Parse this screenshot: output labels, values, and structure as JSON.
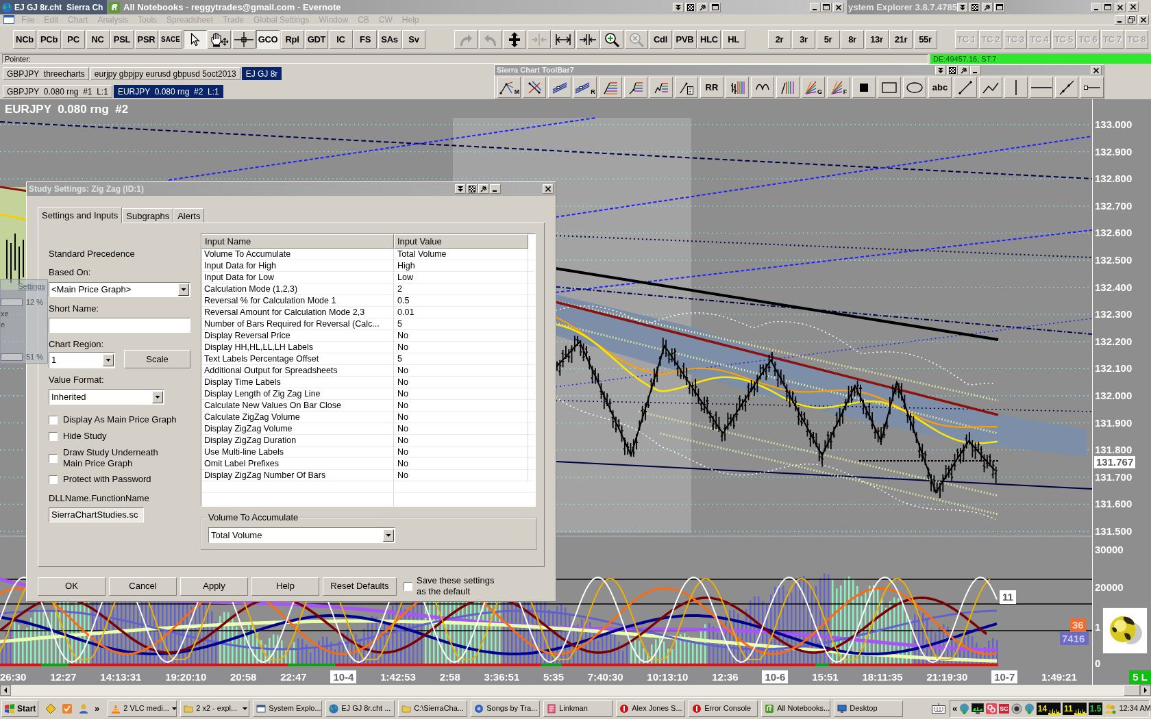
{
  "main_window": {
    "title": "EJ GJ 8r.cht  Sierra Ch"
  },
  "evernote_window": {
    "title": "All Notebooks - reggytrades@gmail.com - Evernote"
  },
  "explorer_window": {
    "title": "ystem Explorer 3.8.7.4785"
  },
  "menu_bar": [
    "File",
    "Edit",
    "Chart",
    "Analysis",
    "Tools",
    "Spreadsheet",
    "Trade",
    "Global Settings",
    "Window",
    "CB",
    "CW",
    "Help"
  ],
  "toolbar": [
    [
      {
        "kind": "text",
        "label": "NCb",
        "pressed": false,
        "disabled": false
      },
      {
        "kind": "text",
        "label": "PCb",
        "pressed": false,
        "disabled": false
      },
      {
        "kind": "text",
        "label": "PC",
        "pressed": false,
        "disabled": false
      },
      {
        "kind": "text",
        "label": "NC",
        "pressed": false,
        "disabled": false
      },
      {
        "kind": "text",
        "label": "PSL",
        "pressed": false,
        "disabled": false
      },
      {
        "kind": "text",
        "label": "PSR",
        "pressed": false,
        "disabled": false
      },
      {
        "kind": "smalltext",
        "label": "SACE",
        "pressed": false,
        "disabled": false
      },
      {
        "kind": "pointer",
        "pressed": true,
        "disabled": false
      },
      {
        "kind": "hand",
        "pressed": false,
        "disabled": false
      },
      {
        "kind": "crosshair",
        "pressed": false,
        "disabled": false
      },
      {
        "kind": "text",
        "label": "GCO",
        "pressed": true,
        "disabled": false
      },
      {
        "kind": "text",
        "label": "Rpl",
        "pressed": false,
        "disabled": false
      },
      {
        "kind": "text",
        "label": "GDT",
        "pressed": false,
        "disabled": false
      },
      {
        "kind": "text",
        "label": "IC",
        "pressed": false,
        "disabled": false
      },
      {
        "kind": "text",
        "label": "FS",
        "pressed": false,
        "disabled": false
      },
      {
        "kind": "text",
        "label": "SAs",
        "pressed": false,
        "disabled": false
      },
      {
        "kind": "text",
        "label": "Sv",
        "pressed": false,
        "disabled": false
      }
    ],
    [
      {
        "kind": "redo",
        "pressed": false,
        "disabled": true
      },
      {
        "kind": "undo",
        "pressed": false,
        "disabled": true
      },
      {
        "kind": "move",
        "pressed": false,
        "disabled": false
      },
      {
        "kind": "squeeze",
        "pressed": false,
        "disabled": true
      },
      {
        "kind": "stretch",
        "pressed": false,
        "disabled": false
      },
      {
        "kind": "compress",
        "pressed": false,
        "disabled": false
      },
      {
        "kind": "zoomin",
        "pressed": false,
        "disabled": false
      },
      {
        "kind": "zoomout",
        "pressed": false,
        "disabled": true
      },
      {
        "kind": "text",
        "label": "Cdl",
        "pressed": false,
        "disabled": false
      },
      {
        "kind": "text",
        "label": "PVB",
        "pressed": false,
        "disabled": false
      },
      {
        "kind": "text",
        "label": "HLC",
        "pressed": false,
        "disabled": false
      },
      {
        "kind": "text",
        "label": "HL",
        "pressed": false,
        "disabled": false
      }
    ],
    [
      {
        "kind": "text",
        "label": "2r",
        "pressed": false,
        "disabled": false
      },
      {
        "kind": "text",
        "label": "3r",
        "pressed": false,
        "disabled": false
      },
      {
        "kind": "text",
        "label": "5r",
        "pressed": false,
        "disabled": false
      },
      {
        "kind": "text",
        "label": "8r",
        "pressed": false,
        "disabled": false
      },
      {
        "kind": "text",
        "label": "13r",
        "pressed": false,
        "disabled": false
      },
      {
        "kind": "text",
        "label": "21r",
        "pressed": false,
        "disabled": false
      },
      {
        "kind": "text",
        "label": "55r",
        "pressed": false,
        "disabled": false
      }
    ],
    [
      {
        "kind": "text",
        "label": "TC 1",
        "pressed": false,
        "disabled": true
      },
      {
        "kind": "text",
        "label": "TC 2",
        "pressed": false,
        "disabled": true
      },
      {
        "kind": "text",
        "label": "TC 3",
        "pressed": false,
        "disabled": true
      },
      {
        "kind": "text",
        "label": "TC 4",
        "pressed": false,
        "disabled": true
      },
      {
        "kind": "text",
        "label": "TC 5",
        "pressed": false,
        "disabled": true
      },
      {
        "kind": "text",
        "label": "TC 6",
        "pressed": false,
        "disabled": true
      },
      {
        "kind": "text",
        "label": "TC 7",
        "pressed": false,
        "disabled": true
      },
      {
        "kind": "text",
        "label": "TC 8",
        "pressed": false,
        "disabled": true
      }
    ]
  ],
  "status_line": {
    "label": "Pointer:",
    "readout": "DE:49457.16, ST:7"
  },
  "chartbook_tabs": [
    {
      "label": "GBPJPY  threecharts",
      "selected": false
    },
    {
      "label": "eurjpy gbpjpy eurusd gbpusd 5oct2013",
      "selected": false
    },
    {
      "label": "EJ GJ 8r",
      "selected": true
    }
  ],
  "chart_tabs": [
    {
      "label": "GBPJPY  0.080 rng  #1  L:1",
      "selected": false
    },
    {
      "label": "EURJPY  0.080 rng  #2  L:1",
      "selected": true
    }
  ],
  "toolbar7": {
    "title": "Sierra Chart ToolBar7",
    "tools": [
      {
        "kind": "pitchfork",
        "letter": "M"
      },
      {
        "kind": "crossed"
      },
      {
        "kind": "parallel"
      },
      {
        "kind": "parallel",
        "letter": "R"
      },
      {
        "kind": "fibretrace"
      },
      {
        "kind": "fibext"
      },
      {
        "kind": "fibzig"
      },
      {
        "kind": "calculator"
      },
      {
        "kind": "text",
        "label": "RR"
      },
      {
        "kind": "barfib"
      },
      {
        "kind": "arc"
      },
      {
        "kind": "timefib"
      },
      {
        "kind": "fan",
        "letter": "G"
      },
      {
        "kind": "fan",
        "letter": "F"
      },
      {
        "kind": "square"
      },
      {
        "kind": "rectangle"
      },
      {
        "kind": "ellipse"
      },
      {
        "kind": "text",
        "label": "abc"
      },
      {
        "kind": "line"
      },
      {
        "kind": "polyline"
      },
      {
        "kind": "vline"
      },
      {
        "kind": "hline"
      },
      {
        "kind": "ray"
      },
      {
        "kind": "hray"
      }
    ]
  },
  "chart": {
    "title": "EURJPY  0.080 rng  #2",
    "price_labels": [
      "133.000",
      "132.900",
      "132.800",
      "132.700",
      "132.600",
      "132.500",
      "132.400",
      "132.300",
      "132.200",
      "132.100",
      "132.000",
      "131.900",
      "131.800",
      "131.700",
      "131.600",
      "131.500"
    ],
    "current_price": "131.767",
    "lower_labels": [
      "30000",
      "20000",
      "1",
      "0"
    ],
    "oscillator_value": "11",
    "badges": [
      {
        "text": "36",
        "color": "#f26b2a"
      },
      {
        "text": "7416",
        "color": "#6b6bc4"
      }
    ]
  },
  "time_axis": {
    "labels": [
      {
        "text": "26:30",
        "kind": "time"
      },
      {
        "text": "12:27",
        "kind": "time"
      },
      {
        "text": "14:13:31",
        "kind": "time"
      },
      {
        "text": "19:20:10",
        "kind": "time"
      },
      {
        "text": "20:58",
        "kind": "time"
      },
      {
        "text": "22:47",
        "kind": "time"
      },
      {
        "text": "10-4",
        "kind": "date"
      },
      {
        "text": "1:42:53",
        "kind": "time"
      },
      {
        "text": "2:58",
        "kind": "time"
      },
      {
        "text": "3:36:51",
        "kind": "time"
      },
      {
        "text": "5:35",
        "kind": "time"
      },
      {
        "text": "7:40:30",
        "kind": "time"
      },
      {
        "text": "10:13:10",
        "kind": "time"
      },
      {
        "text": "12:36",
        "kind": "time"
      },
      {
        "text": "10-6",
        "kind": "date"
      },
      {
        "text": "15:51",
        "kind": "time"
      },
      {
        "text": "18:11:35",
        "kind": "time"
      },
      {
        "text": "21:19:30",
        "kind": "time"
      },
      {
        "text": "10-7",
        "kind": "date"
      },
      {
        "text": "1:49:21",
        "kind": "time"
      }
    ],
    "bar_count": "5 L"
  },
  "dialog": {
    "title": "Study Settings: Zig Zag (ID:1)",
    "tabs": [
      {
        "label": "Settings and Inputs",
        "selected": true
      },
      {
        "label": "Subgraphs",
        "selected": false
      },
      {
        "label": "Alerts",
        "selected": false
      }
    ],
    "precedence": "Standard Precedence",
    "based_on": {
      "label": "Based On:",
      "value": "<Main Price Graph>"
    },
    "short_name": {
      "label": "Short Name:"
    },
    "chart_region": {
      "label": "Chart Region:",
      "value": "1"
    },
    "scale_button": "Scale",
    "value_format": {
      "label": "Value Format:",
      "value": "Inherited"
    },
    "checkboxes": [
      {
        "label": "Display As Main Price Graph",
        "checked": false
      },
      {
        "label": "Hide Study",
        "checked": false
      },
      {
        "label": "Draw Study Underneath\nMain Price Graph",
        "checked": false
      },
      {
        "label": "Protect with Password",
        "checked": false
      }
    ],
    "dll": {
      "label": "DLLName.FunctionName",
      "value": "SierraChartStudies.sc"
    },
    "inputs_table": {
      "columns": [
        "Input Name",
        "Input Value"
      ],
      "rows": [
        [
          "Volume To Accumulate",
          "Total Volume"
        ],
        [
          "Input Data for High",
          "High"
        ],
        [
          "Input Data for Low",
          "Low"
        ],
        [
          "Calculation Mode (1,2,3)",
          "2"
        ],
        [
          "Reversal % for Calculation Mode 1",
          "0.5"
        ],
        [
          "Reversal Amount for Calculation Mode 2,3",
          "0.01"
        ],
        [
          "Number of Bars Required for Reversal (Calc...",
          "5"
        ],
        [
          "Display Reversal Price",
          "No"
        ],
        [
          "Display HH,HL,LL,LH Labels",
          "No"
        ],
        [
          "Text Labels Percentage Offset",
          "5"
        ],
        [
          "Additional Output for Spreadsheets",
          "No"
        ],
        [
          "Display Time Labels",
          "No"
        ],
        [
          "Display Length of Zig Zag Line",
          "No"
        ],
        [
          "Calculate New Values On Bar Close",
          "No"
        ],
        [
          "Calculate ZigZag Volume",
          "No"
        ],
        [
          "Display ZigZag Volume",
          "No"
        ],
        [
          "Display ZigZag Duration",
          "No"
        ],
        [
          "Use Multi-line Labels",
          "No"
        ],
        [
          "Omit Label Prefixes",
          "No"
        ],
        [
          "Display ZigZag Number Of Bars",
          "No"
        ]
      ]
    },
    "input_group": {
      "title": "Volume To Accumulate",
      "value": "Total Volume"
    },
    "buttons": [
      "OK",
      "Cancel",
      "Apply",
      "Help",
      "Reset Defaults"
    ],
    "save_default": {
      "label": "Save these settings\nas the default",
      "checked": false
    }
  },
  "settings_overlay": {
    "link": "Settings",
    "values": [
      "12 %",
      "51 %"
    ],
    "fragments": [
      "xe",
      "e"
    ]
  },
  "taskbar": {
    "start": "Start",
    "launch_more": "»",
    "tasks": [
      {
        "kind": "vlc",
        "label": "2 VLC medi...",
        "grouped": true,
        "selected": false
      },
      {
        "kind": "folder",
        "label": "2 x2 - expl...",
        "grouped": true,
        "selected": false
      },
      {
        "kind": "explorer",
        "label": "System Explo...",
        "grouped": false,
        "selected": false
      },
      {
        "kind": "globe",
        "label": "EJ GJ 8r.cht ...",
        "grouped": false,
        "selected": false
      },
      {
        "kind": "folder",
        "label": "C:\\SierraCha...",
        "grouped": false,
        "selected": false
      },
      {
        "kind": "music",
        "label": "Songs by Tra...",
        "grouped": false,
        "selected": false
      },
      {
        "kind": "link",
        "label": "Linkman",
        "grouped": false,
        "selected": false
      },
      {
        "kind": "error",
        "label": "Alex Jones S...",
        "grouped": false,
        "selected": false
      },
      {
        "kind": "error",
        "label": "Error Console",
        "grouped": false,
        "selected": false
      },
      {
        "kind": "notes",
        "label": "All Notebooks...",
        "grouped": false,
        "selected": false
      },
      {
        "kind": "desktop",
        "label": "Desktop",
        "grouped": false,
        "selected": false
      }
    ],
    "tray_more": "«",
    "tray_app": "SC",
    "meters": [
      {
        "text": "14",
        "kind": "graph"
      },
      {
        "text": "11",
        "kind": "graph"
      },
      {
        "text": "1.5",
        "kind": "plain"
      }
    ],
    "clock": "12:34 AM"
  }
}
